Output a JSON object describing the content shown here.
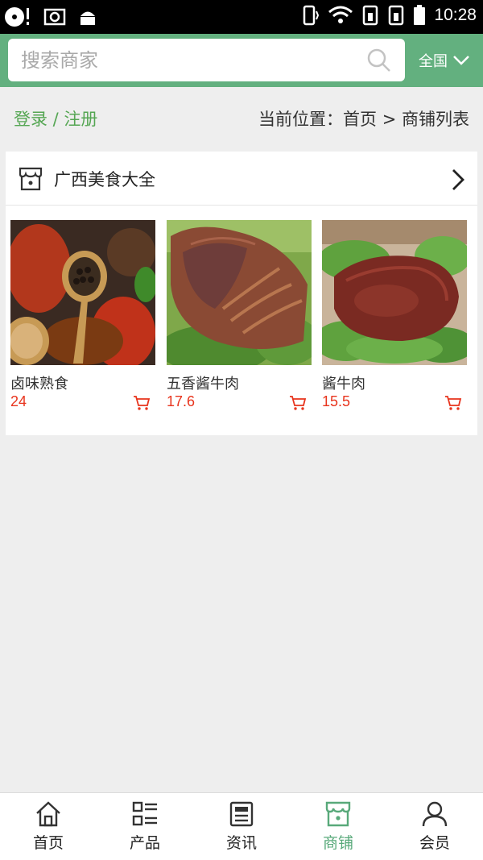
{
  "status_bar": {
    "time": "10:28"
  },
  "search": {
    "placeholder": "搜索商家"
  },
  "region": {
    "label": "全国"
  },
  "login": {
    "label": "登录 / 注册"
  },
  "breadcrumb": {
    "text": "当前位置：首页 > 商铺列表"
  },
  "store": {
    "name": "广西美食大全",
    "products": [
      {
        "name": "卤味熟食",
        "price": "24"
      },
      {
        "name": "五香酱牛肉",
        "price": "17.6"
      },
      {
        "name": "酱牛肉",
        "price": "15.5"
      }
    ]
  },
  "bottom_nav": [
    {
      "label": "首页",
      "icon": "home-icon",
      "active": false
    },
    {
      "label": "产品",
      "icon": "product-list-icon",
      "active": false
    },
    {
      "label": "资讯",
      "icon": "news-icon",
      "active": false
    },
    {
      "label": "商铺",
      "icon": "store-icon",
      "active": true
    },
    {
      "label": "会员",
      "icon": "member-icon",
      "active": false
    }
  ],
  "colors": {
    "accent": "#63b07f",
    "price": "#e8341d",
    "link": "#55a653"
  }
}
